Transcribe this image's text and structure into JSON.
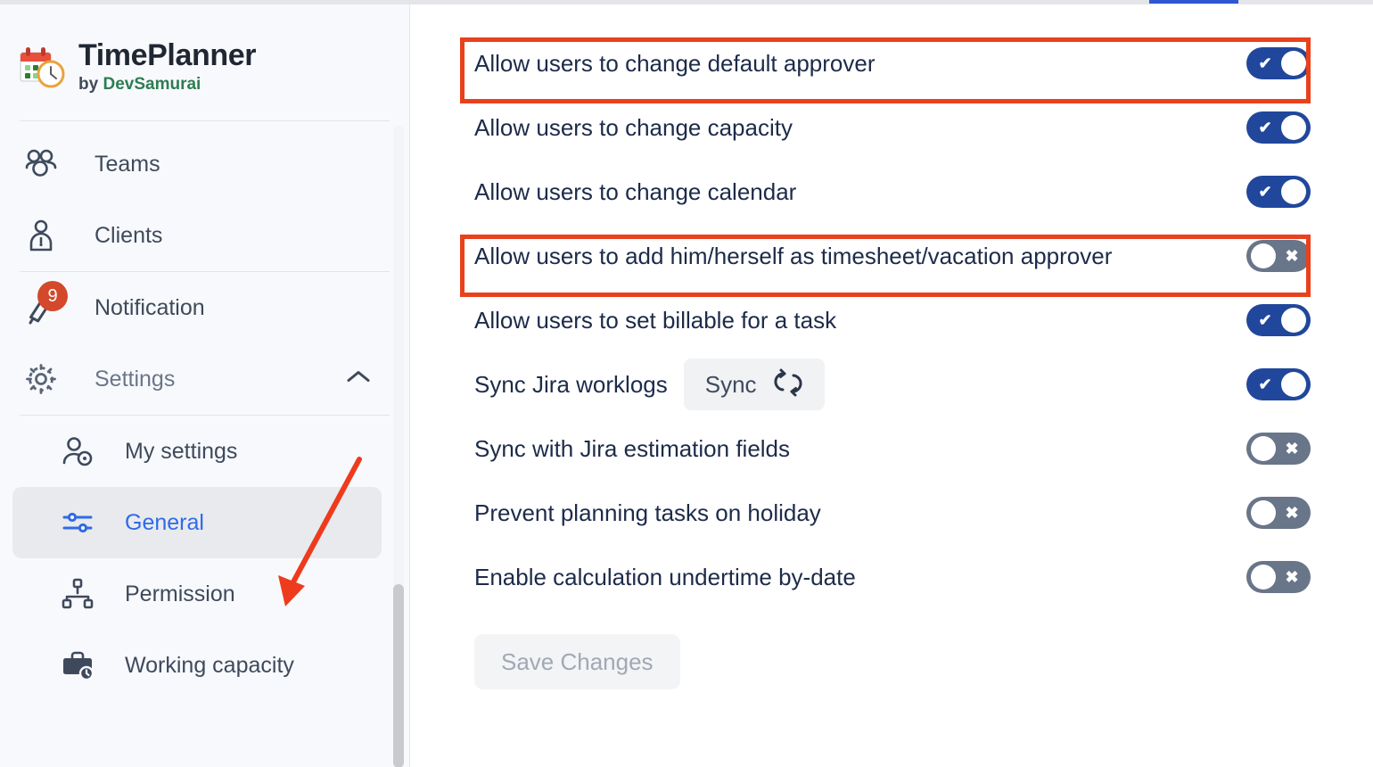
{
  "app": {
    "title": "TimePlanner",
    "byline_prefix": "by",
    "vendor": "DevSamurai",
    "logo_icon": "calendar-clock-icon"
  },
  "sidebar": {
    "items": [
      {
        "label": "Teams",
        "icon": "people-group-icon",
        "active": false
      },
      {
        "label": "Clients",
        "icon": "client-user-lock-icon",
        "active": false
      },
      {
        "label": "Notification",
        "icon": "bell-icon",
        "badge": "9",
        "active": false
      },
      {
        "label": "Settings",
        "icon": "gear-icon",
        "chevron": "chevron-up-icon",
        "active": false,
        "muted": true
      }
    ],
    "sub_items": [
      {
        "label": "My settings",
        "icon": "user-settings-icon",
        "active": false
      },
      {
        "label": "General",
        "icon": "sliders-icon",
        "active": true
      },
      {
        "label": "Permission",
        "icon": "org-chart-icon",
        "active": false
      },
      {
        "label": "Working capacity",
        "icon": "briefcase-clock-icon",
        "active": false
      }
    ]
  },
  "main": {
    "settings": [
      {
        "label": "Allow users to change default approver",
        "state": "on",
        "highlighted": true
      },
      {
        "label": "Allow users to change capacity",
        "state": "on",
        "highlighted": false
      },
      {
        "label": "Allow users to change calendar",
        "state": "on",
        "highlighted": false
      },
      {
        "label": "Allow users to add him/herself as timesheet/vacation approver",
        "state": "off",
        "highlighted": true
      },
      {
        "label": "Allow users to set billable for a task",
        "state": "on",
        "highlighted": false
      },
      {
        "label": "Sync Jira worklogs",
        "state": "on",
        "highlighted": false,
        "button": {
          "label": "Sync",
          "icon": "sync-refresh-icon"
        }
      },
      {
        "label": "Sync with Jira estimation fields",
        "state": "off",
        "highlighted": false
      },
      {
        "label": "Prevent planning tasks on holiday",
        "state": "off",
        "highlighted": false
      },
      {
        "label": "Enable calculation undertime by-date",
        "state": "off",
        "highlighted": false
      }
    ],
    "save_label": "Save Changes",
    "toggle_on_glyph": "✔",
    "toggle_off_glyph": "✖"
  },
  "colors": {
    "toggle_on": "#21479c",
    "toggle_off": "#697588",
    "accent_blue": "#2f6ae8",
    "annotation_red": "#e8411c",
    "badge_red": "#d2492b",
    "vendor_green": "#2e7d52",
    "tab_underline": "#2f57d1"
  }
}
